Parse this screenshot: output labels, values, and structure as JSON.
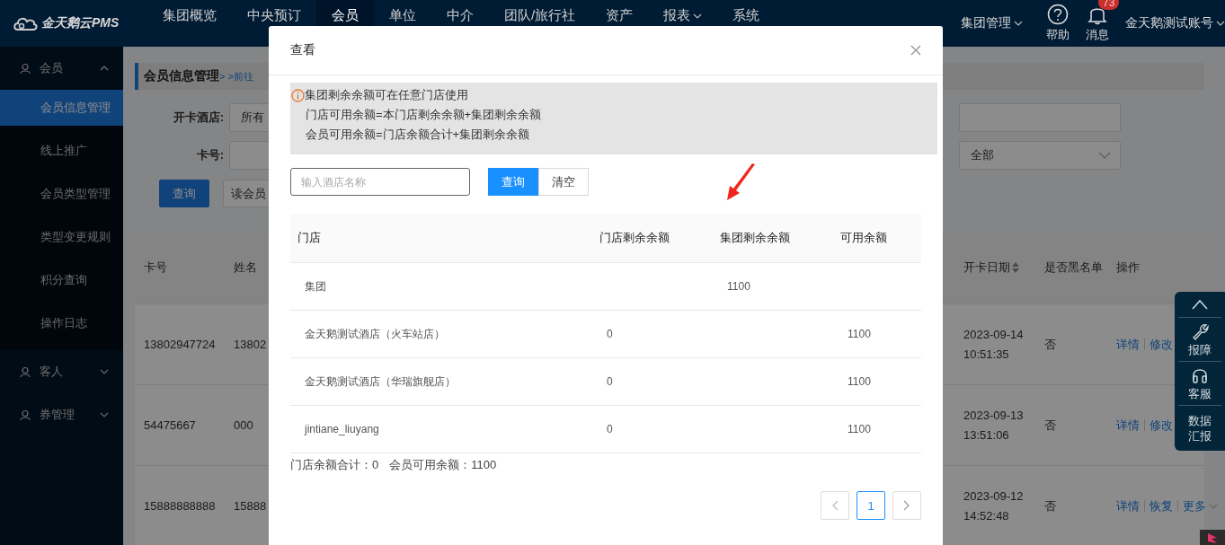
{
  "top_nav": {
    "logo": "金天鹅云PMS",
    "items": [
      {
        "label": "集团概览",
        "selected": false,
        "has_menu": false
      },
      {
        "label": "中央预订",
        "selected": false,
        "has_menu": false
      },
      {
        "label": "会员",
        "selected": true,
        "has_menu": false
      },
      {
        "label": "单位",
        "selected": false,
        "has_menu": false
      },
      {
        "label": "中介",
        "selected": false,
        "has_menu": false
      },
      {
        "label": "团队/旅行社",
        "selected": false,
        "has_menu": false
      },
      {
        "label": "资产",
        "selected": false,
        "has_menu": false
      },
      {
        "label": "报表",
        "selected": false,
        "has_menu": true
      },
      {
        "label": "系统",
        "selected": false,
        "has_menu": false
      }
    ],
    "group_menu": "集团管理",
    "help": "帮助",
    "messages": {
      "label": "消息",
      "badge": "73"
    },
    "account": "金天鹅测试账号"
  },
  "sidebar": {
    "sections": [
      {
        "label": "会员",
        "expanded": true,
        "children": [
          {
            "label": "会员信息管理",
            "selected": true
          },
          {
            "label": "线上推广",
            "selected": false
          },
          {
            "label": "会员类型管理",
            "selected": false
          },
          {
            "label": "类型变更规则",
            "selected": false
          },
          {
            "label": "积分查询",
            "selected": false
          },
          {
            "label": "操作日志",
            "selected": false
          }
        ]
      },
      {
        "label": "客人",
        "expanded": false
      },
      {
        "label": "券管理",
        "expanded": false
      }
    ]
  },
  "page": {
    "breadcrumb": {
      "title": "会员信息管理",
      "link": "> >前往"
    },
    "form_left": [
      {
        "label": "开卡酒店:",
        "kind": "select",
        "value": "所有"
      },
      {
        "label": "卡号:",
        "kind": "input"
      }
    ],
    "form_right": [
      {
        "kind": "input"
      },
      {
        "kind": "select",
        "value": "全部"
      }
    ],
    "buttons": [
      "查询",
      "读会员"
    ],
    "table": {
      "columns": [
        {
          "label": "卡号",
          "sortable": false
        },
        {
          "label": "姓名",
          "sortable": false
        },
        {
          "label": "开卡日期",
          "sortable": true
        },
        {
          "label": "是否黑名单",
          "sortable": false
        },
        {
          "label": "操作",
          "sortable": false
        }
      ],
      "rows": [
        {
          "card": "13802947724",
          "name": "13802",
          "opened": "2023-09-14 10:51:35",
          "blacklist": "否",
          "actions": [
            "详情",
            "修改"
          ]
        },
        {
          "card": "54475667",
          "name": "000",
          "opened": "2023-09-13 13:51:06",
          "blacklist": "否",
          "actions": [
            "详情",
            "修改"
          ]
        },
        {
          "card": "15888888888",
          "name": "15888",
          "opened": "2023-09-12 14:52:48",
          "blacklist": "否",
          "actions": [
            "详情",
            "恢复"
          ],
          "more": "更多"
        }
      ]
    }
  },
  "float_panel": [
    {
      "kind": "top"
    },
    {
      "kind": "wrench",
      "label": "报障"
    },
    {
      "kind": "headset",
      "label": "客服"
    },
    {
      "kind": "text",
      "label": "数据汇报"
    }
  ],
  "dialog": {
    "title": "查看",
    "notice": [
      "集团剩余余额可在任意门店使用",
      "门店可用余额=本门店剩余余额+集团剩余余额",
      "会员可用余额=门店余额合计+集团剩余余额"
    ],
    "search": {
      "placeholder": "输入酒店名称"
    },
    "buttons": [
      {
        "label": "查询",
        "kind": "primary"
      },
      {
        "label": "清空",
        "kind": "default"
      }
    ],
    "table": {
      "columns": [
        "门店",
        "门店剩余余额",
        "集团剩余余额",
        "可用余额"
      ],
      "rows": [
        [
          "集团",
          null,
          "1100",
          null
        ],
        [
          "金天鹅测试酒店（火车站店）",
          "0",
          null,
          "1100"
        ],
        [
          "金天鹅测试酒店（华瑞旗舰店）",
          "0",
          null,
          "1100"
        ],
        [
          "jintiane_liuyang",
          "0",
          null,
          "1100"
        ]
      ]
    },
    "summary": [
      "门店余额合计：0",
      "会员可用余额：1100"
    ],
    "pages": [
      {
        "label": "1",
        "selected": true
      }
    ]
  }
}
